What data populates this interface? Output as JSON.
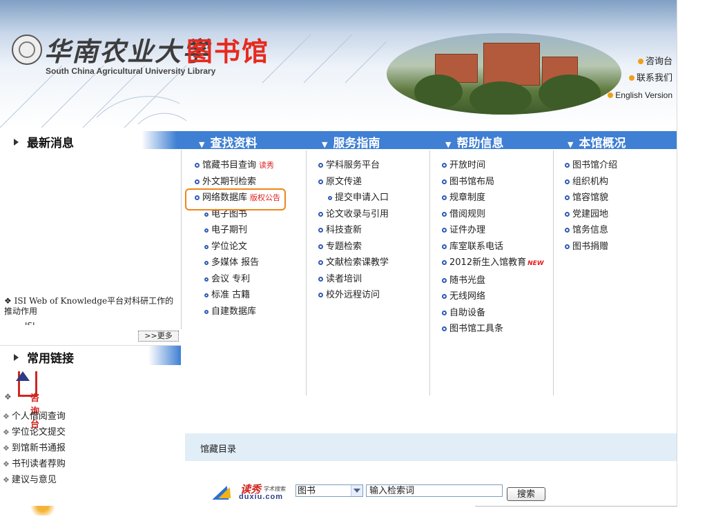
{
  "header": {
    "university_cn": "华南农业大学",
    "library_cn": "图书馆",
    "university_en": "South China Agricultural University Library",
    "top_links": [
      "咨询台",
      "联系我们",
      "English Version"
    ]
  },
  "nav": {
    "news_label": "最新消息",
    "tabs": [
      "查找资料",
      "服务指南",
      "帮助信息",
      "本馆概况"
    ]
  },
  "news": {
    "item1": "ISI Web of Knowledge平台对科研工作的推动作用",
    "item2_partial": "…  ISI …  …",
    "more": ">>更多"
  },
  "links": {
    "label": "常用链接",
    "hotline": "咨询台",
    "items": [
      "个人借阅查询",
      "学位论文提交",
      "到馆新书通报",
      "书刊读者荐购",
      "建议与意见"
    ]
  },
  "columns": {
    "find": {
      "items": [
        {
          "text": "馆藏书目查询",
          "tag": "读秀"
        },
        {
          "text": "外文期刊检索"
        },
        {
          "text": "网络数据库",
          "tag": "版权公告"
        }
      ],
      "subitems": [
        "电子图书",
        "电子期刊",
        "学位论文",
        "多媒体 报告",
        "会议  专利",
        "标准  古籍",
        "自建数据库"
      ]
    },
    "service": {
      "items": [
        "学科服务平台",
        "原文传递"
      ],
      "sub": "提交申请入口",
      "items2": [
        "论文收录与引用",
        "科技查新",
        "专题检索",
        "文献检索课教学",
        "读者培训",
        "校外远程访问"
      ]
    },
    "help": {
      "items": [
        "开放时间",
        "图书馆布局",
        "规章制度",
        "借阅规则",
        "证件办理",
        "库室联系电话",
        "2012新生入馆教育",
        "随书光盘",
        "无线网络",
        "自助设备",
        "图书馆工具条"
      ],
      "new_tag": "NEW"
    },
    "about": {
      "items": [
        "图书馆介绍",
        "组织机构",
        "馆容馆貌",
        "党建园地",
        "馆务信息",
        "图书捐赠"
      ]
    }
  },
  "catalog": {
    "title": "馆藏目录",
    "duxiu_name": "读秀",
    "duxiu_sub": "学术搜索",
    "duxiu_url": "duxiu.com",
    "select_value": "图书",
    "input_value": "输入检索词",
    "search_button": "搜索"
  }
}
